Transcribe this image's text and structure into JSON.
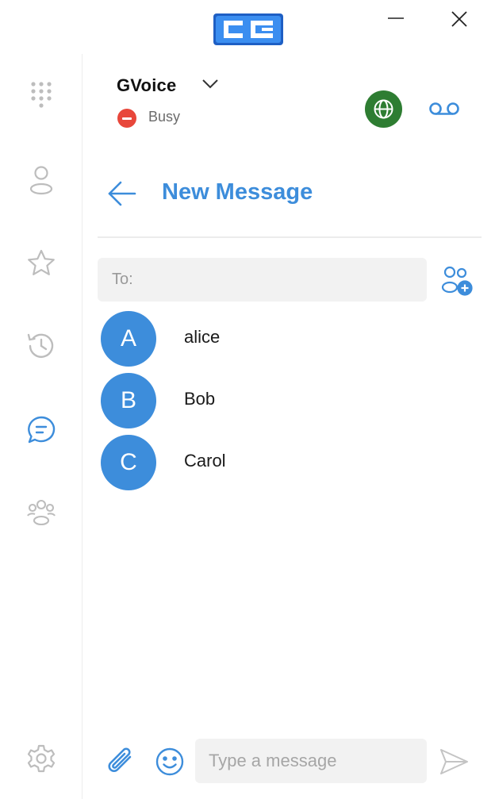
{
  "app": {
    "logo_text": "CC"
  },
  "window": {
    "minimize_icon": "minimize-icon",
    "close_icon": "close-icon"
  },
  "sidebar": {
    "items": [
      {
        "id": "dialpad",
        "icon": "dialpad-icon",
        "active": false
      },
      {
        "id": "contacts",
        "icon": "person-icon",
        "active": false
      },
      {
        "id": "favorites",
        "icon": "star-icon",
        "active": false
      },
      {
        "id": "history",
        "icon": "history-icon",
        "active": false
      },
      {
        "id": "messages",
        "icon": "chat-icon",
        "active": true
      },
      {
        "id": "groups",
        "icon": "group-icon",
        "active": false
      }
    ],
    "settings_icon": "gear-icon"
  },
  "header": {
    "account_name": "GVoice",
    "status": "Busy",
    "status_color": "#e8473b",
    "globe_color": "#2e7d32"
  },
  "page": {
    "title": "New Message",
    "accent": "#3d8ddb"
  },
  "compose": {
    "to_placeholder": "To:",
    "to_value": "",
    "message_placeholder": "Type a message",
    "message_value": ""
  },
  "contacts": [
    {
      "initial": "A",
      "name": "alice"
    },
    {
      "initial": "B",
      "name": "Bob"
    },
    {
      "initial": "C",
      "name": "Carol"
    }
  ]
}
